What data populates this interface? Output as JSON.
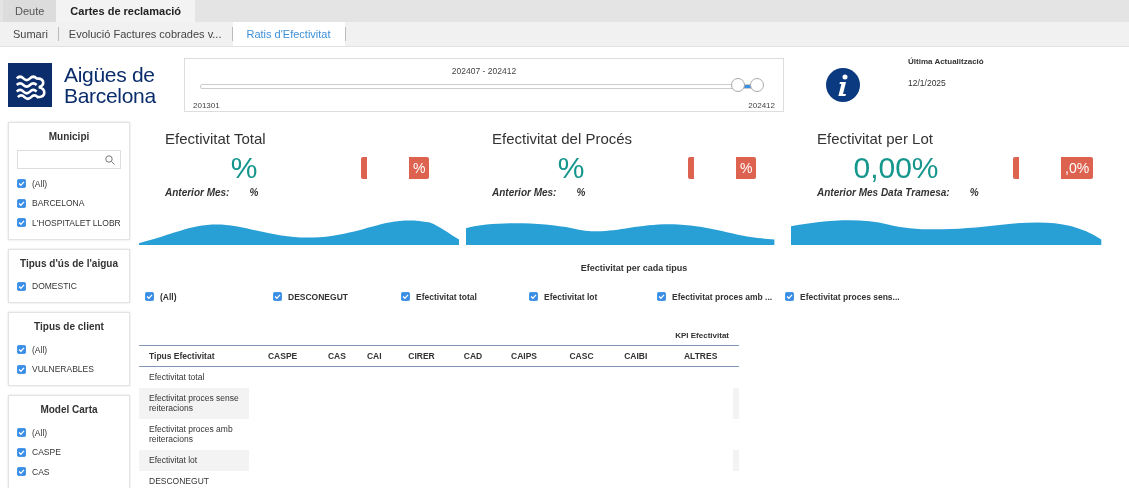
{
  "tabs": [
    {
      "label": "Deute",
      "selected": false
    },
    {
      "label": "Cartes de reclamació",
      "selected": true
    }
  ],
  "subtabs": [
    {
      "label": "Sumari",
      "selected": false
    },
    {
      "label": "Evolució Factures cobrades v...",
      "selected": false
    },
    {
      "label": "Ratis d'Efectivitat",
      "selected": true
    }
  ],
  "logo": {
    "line_1": "Aigües de",
    "line_2": "Barcelona"
  },
  "period_slider": {
    "range_label": "202407 - 202412",
    "min_label": "201301",
    "max_label": "202412",
    "low": {
      "level": 0.965
    },
    "high": {
      "level": 1.0
    }
  },
  "last_update": {
    "title": "Última Actualització",
    "date": "12/1/2025"
  },
  "filters": [
    {
      "title": "Municipi",
      "has_search": true,
      "items": [
        {
          "label": "(All)",
          "checked": true
        },
        {
          "label": "BARCELONA",
          "checked": true
        },
        {
          "label": "L'HOSPITALET LLOBR",
          "checked": true
        }
      ]
    },
    {
      "title": "Tipus d'ús de l'aigua",
      "has_search": false,
      "items": [
        {
          "label": "DOMESTIC",
          "checked": true
        }
      ]
    },
    {
      "title": "Tipus de client",
      "has_search": false,
      "items": [
        {
          "label": "(All)",
          "checked": true
        },
        {
          "label": "VULNERABLES",
          "checked": true
        }
      ]
    },
    {
      "title": "Model Carta",
      "has_search": false,
      "items": [
        {
          "label": "(All)",
          "checked": true
        },
        {
          "label": "CASPE",
          "checked": true
        },
        {
          "label": "CAS",
          "checked": true
        }
      ]
    }
  ],
  "kpis": [
    {
      "title": "Efectivitat Total",
      "value": "%",
      "badge": "%",
      "previous_label": "Anterior Mes:",
      "previous_value": "%"
    },
    {
      "title": "Efectivitat del Procés",
      "value": "%",
      "badge": "%",
      "previous_label": "Anterior Mes:",
      "previous_value": "%"
    },
    {
      "title": "Efectivitat per Lot",
      "value": "0,00%",
      "badge": ",0%",
      "previous_label": "Anterior Mes Data Tramesa:",
      "previous_value": "%"
    }
  ],
  "type_filter": {
    "title": "Efectivitat per cada tipus",
    "items": [
      {
        "label": "(All)",
        "checked": true
      },
      {
        "label": "DESCONEGUT",
        "checked": true
      },
      {
        "label": "Efectivitat total",
        "checked": true
      },
      {
        "label": "Efectivitat lot",
        "checked": true
      },
      {
        "label": "Efectivitat proces amb ...",
        "checked": true
      },
      {
        "label": "Efectivitat proces sens...",
        "checked": true
      }
    ]
  },
  "table": {
    "title": "KPI Efectivitat",
    "columns": [
      "Tipus Efectivitat",
      "CASPE",
      "CAS",
      "CAI",
      "CIRER",
      "CAD",
      "CAIPS",
      "CASC",
      "CAIBI",
      "ALTRES"
    ],
    "rows": [
      {
        "label": "Efectivitat total",
        "shaded": false
      },
      {
        "label": "Efectivitat proces sense reiteracions",
        "shaded": true
      },
      {
        "label": "Efectivitat proces amb reiteracions",
        "shaded": false
      },
      {
        "label": "Efectivitat lot",
        "shaded": true
      },
      {
        "label": "DESCONEGUT",
        "shaded": false
      }
    ]
  }
}
